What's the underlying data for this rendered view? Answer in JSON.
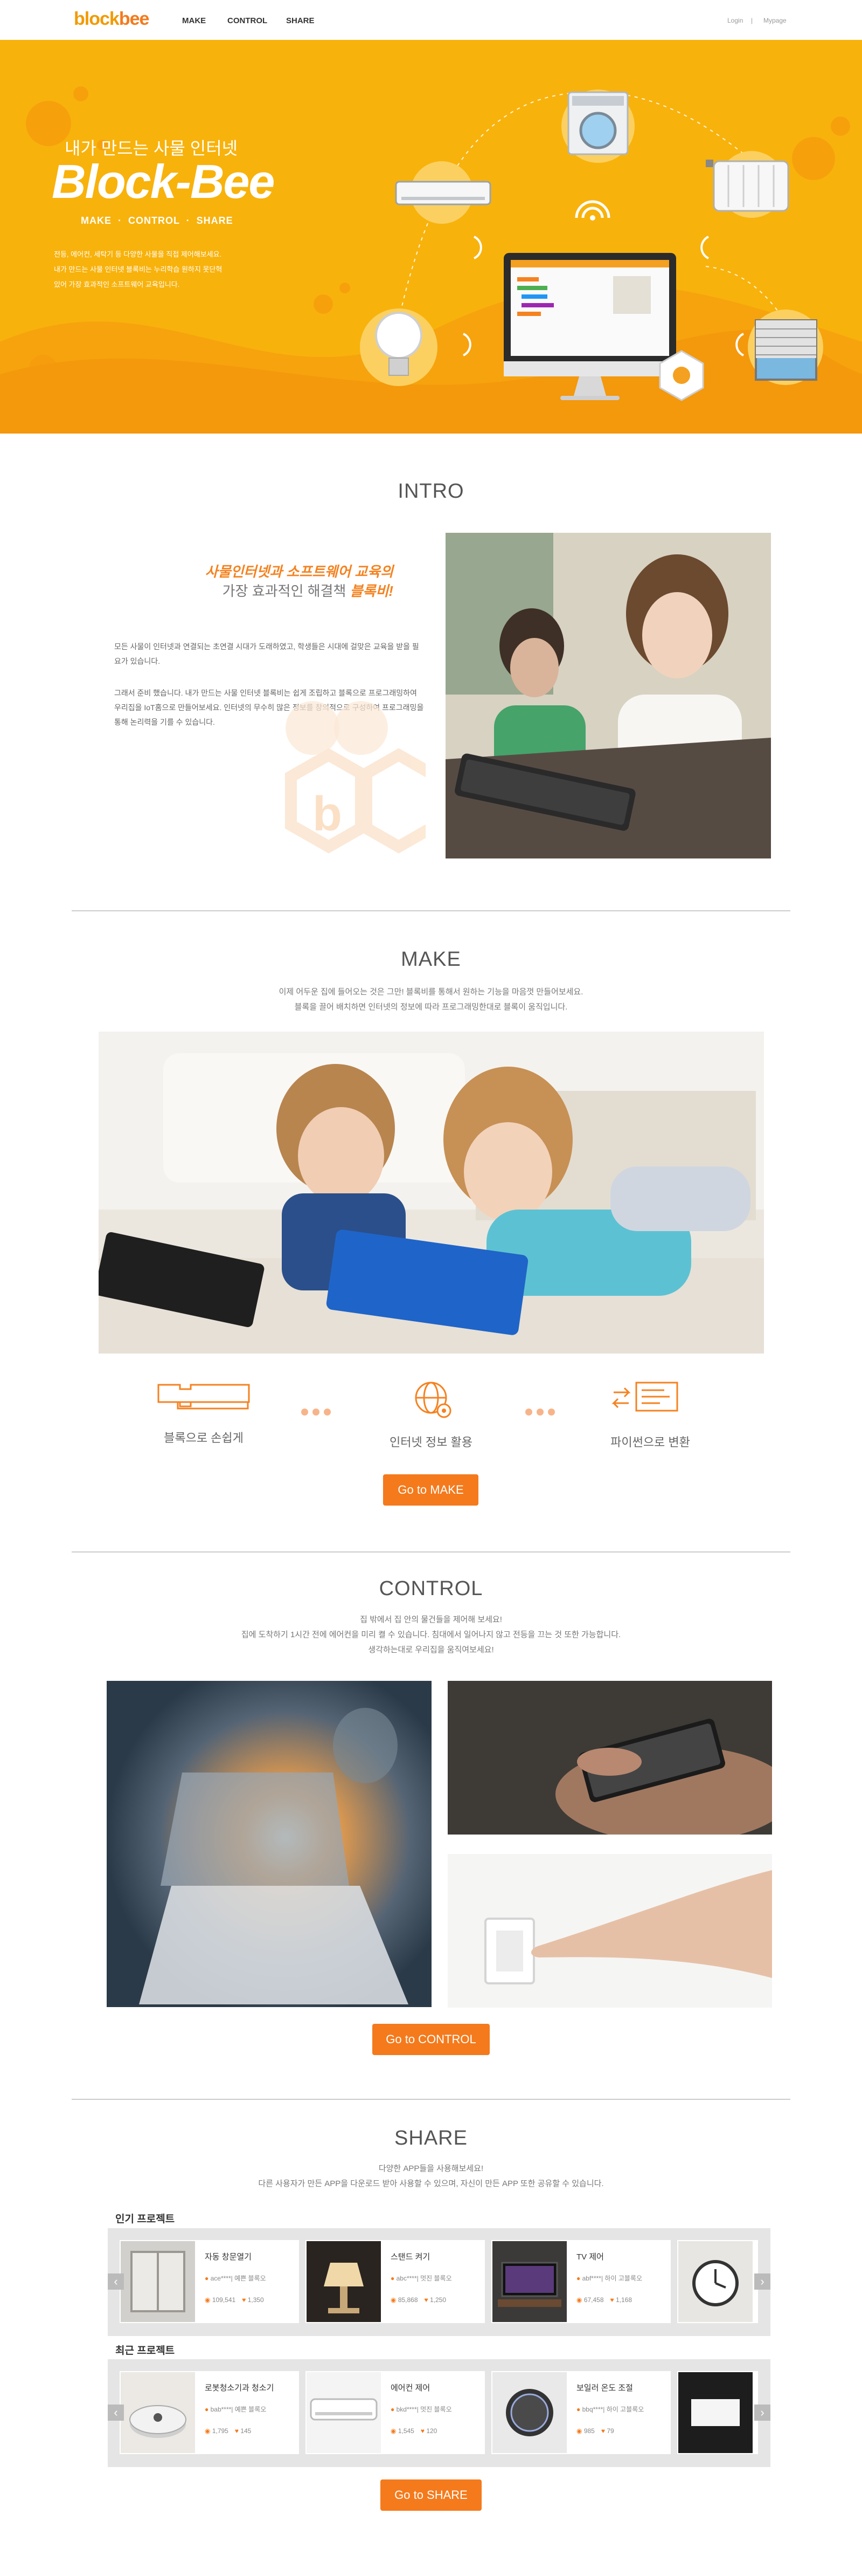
{
  "header": {
    "logo_part1": "block",
    "logo_part2": "bee",
    "nav": [
      "MAKE",
      "CONTROL",
      "SHARE"
    ],
    "login": "Login",
    "divider": "|",
    "mypage": "Mypage"
  },
  "hero": {
    "subtitle": "내가 만드는 사물 인터넷",
    "title": "Block-Bee",
    "menu": "MAKE  ·  CONTROL  ·  SHARE",
    "desc_lines": [
      "전등, 에어컨, 세탁기 등 다양한 사물을 직접 제어해보세요.",
      "내가 만드는 사물 인터넷 블록비는 누리학습 원하지 못단혁",
      "있어 가장 효과적인 소프트웨어 교육입니다."
    ],
    "colors": {
      "bg": "#f8b20c",
      "accent": "#f47a1c"
    }
  },
  "intro": {
    "title": "INTRO",
    "headline_1": "사물인터넷과 소프트웨어 교육의",
    "headline_2_prefix": "가장 효과적인 해결책 ",
    "headline_2_brand": "블록비!",
    "para_1": "모든 사물이 인터넷과 연결되는 초연결 시대가 도래하였고, 학생들은 시대에 걸맞은 교육을 받을 필요가 있습니다.",
    "para_2": "그래서 준비 했습니다. 내가 만드는 사물 인터넷 블록비는 쉽게 조립하고 블록으로 프로그래밍하여 우리집을 IoT홈으로 만들어보세요. 인터넷의 무수히 많은 정보를 창의적으로 구성하여 프로그래밍을 통해 논리력을 기를 수 있습니다."
  },
  "make": {
    "title": "MAKE",
    "desc_lines": [
      "이제 어두운 집에 들어오는 것은 그만! 블록비를 통해서 원하는 기능을 마음껏 만들어보세요.",
      "블록을 끌어 배치하면 인터넷의 정보에 따라 프로그래밍한대로 블록이 움직입니다."
    ],
    "features": [
      "블록으로 손쉽게",
      "인터넷 정보 활용",
      "파이썬으로 변환"
    ],
    "button": "Go to MAKE"
  },
  "control": {
    "title": "CONTROL",
    "desc_lines": [
      "집 밖에서 집 안의 물건들을 제어해 보세요!",
      "집에 도착하기 1시간 전에 에어컨을 미리 켤 수 있습니다. 침대에서 일어나지 않고 전등을 끄는 것 또한 가능합니다.",
      "생각하는대로 우리집을 움직여보세요!"
    ],
    "button": "Go to CONTROL"
  },
  "share": {
    "title": "SHARE",
    "desc_lines": [
      "다양한 APP들을 사용해보세요!",
      "다른 사용자가 만든 APP을 다운로드 받아 사용할 수 있으며, 자신이 만든 APP 또한 공유할 수 있습니다."
    ],
    "popular_label": "인기 프로젝트",
    "recent_label": "최근 프로젝트",
    "popular": [
      {
        "name": "자동 창문열기",
        "user": "ace****| 예쁜 블록오",
        "views": "109,541",
        "likes": "1,350"
      },
      {
        "name": "스탠드 켜기",
        "user": "abc****| 멋진 블록오",
        "views": "85,868",
        "likes": "1,250"
      },
      {
        "name": "TV 제어",
        "user": "abf****| 하이 고블록오",
        "views": "67,458",
        "likes": "1,168"
      }
    ],
    "recent": [
      {
        "name": "로봇청소기과 청소기",
        "user": "bab****| 예쁜 블록오",
        "views": "1,795",
        "likes": "145"
      },
      {
        "name": "에어컨 제어",
        "user": "bkd****| 멋진 블록오",
        "views": "1,545",
        "likes": "120"
      },
      {
        "name": "보일러 온도 조절",
        "user": "bbq****| 하이 고블록오",
        "views": "985",
        "likes": "79"
      }
    ],
    "prev_symbol": "‹",
    "next_symbol": "›",
    "button": "Go to SHARE"
  }
}
